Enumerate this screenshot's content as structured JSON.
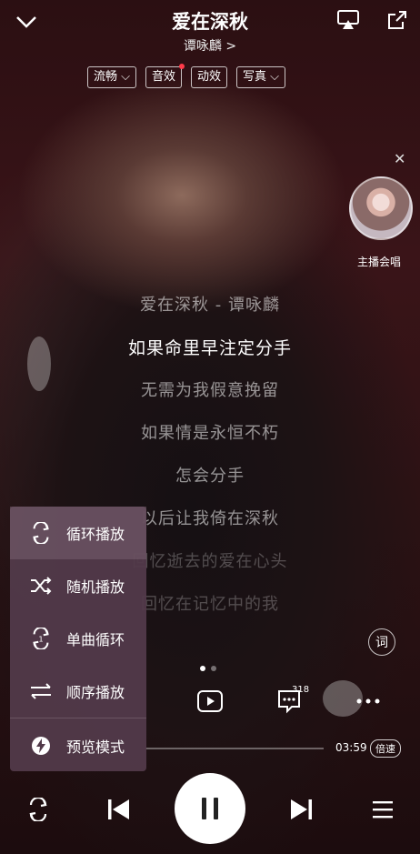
{
  "header": {
    "song_title": "爱在深秋",
    "artist": "谭咏麟 >",
    "chips": [
      {
        "label": "流畅 ⌵"
      },
      {
        "label": "音效"
      },
      {
        "label": "动效"
      },
      {
        "label": "写真 ⌵"
      }
    ]
  },
  "side_card": {
    "label": "主播会唱"
  },
  "lyrics": [
    "爱在深秋 - 谭咏麟",
    "如果命里早注定分手",
    "无需为我假意挽留",
    "如果情是永恒不朽",
    "怎会分手",
    "以后让我倚在深秋",
    "回忆逝去的爱在心头",
    "回忆在记忆中的我"
  ],
  "lyric_button": "词",
  "comments_count": "318",
  "time_total": "03:59",
  "speed_label": "倍速",
  "play_mode_menu": {
    "items": [
      {
        "label": "循环播放",
        "icon": "loop-icon"
      },
      {
        "label": "随机播放",
        "icon": "shuffle-icon"
      },
      {
        "label": "单曲循环",
        "icon": "single-loop-icon"
      },
      {
        "label": "顺序播放",
        "icon": "sequence-icon"
      }
    ],
    "preview_label": "预览模式",
    "selected": "循环播放"
  },
  "colors": {
    "background": "#2a1114",
    "menu": "#523a4a",
    "badge_dot": "#ff3b4a"
  }
}
